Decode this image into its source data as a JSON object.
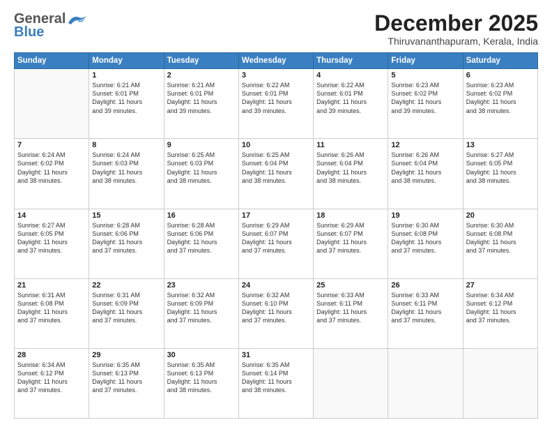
{
  "header": {
    "logo_general": "General",
    "logo_blue": "Blue",
    "month_title": "December 2025",
    "location": "Thiruvananthapuram, Kerala, India"
  },
  "weekdays": [
    "Sunday",
    "Monday",
    "Tuesday",
    "Wednesday",
    "Thursday",
    "Friday",
    "Saturday"
  ],
  "weeks": [
    [
      {
        "day": "",
        "info": ""
      },
      {
        "day": "1",
        "info": "Sunrise: 6:21 AM\nSunset: 6:01 PM\nDaylight: 11 hours\nand 39 minutes."
      },
      {
        "day": "2",
        "info": "Sunrise: 6:21 AM\nSunset: 6:01 PM\nDaylight: 11 hours\nand 39 minutes."
      },
      {
        "day": "3",
        "info": "Sunrise: 6:22 AM\nSunset: 6:01 PM\nDaylight: 11 hours\nand 39 minutes."
      },
      {
        "day": "4",
        "info": "Sunrise: 6:22 AM\nSunset: 6:01 PM\nDaylight: 11 hours\nand 39 minutes."
      },
      {
        "day": "5",
        "info": "Sunrise: 6:23 AM\nSunset: 6:02 PM\nDaylight: 11 hours\nand 39 minutes."
      },
      {
        "day": "6",
        "info": "Sunrise: 6:23 AM\nSunset: 6:02 PM\nDaylight: 11 hours\nand 38 minutes."
      }
    ],
    [
      {
        "day": "7",
        "info": "Sunrise: 6:24 AM\nSunset: 6:02 PM\nDaylight: 11 hours\nand 38 minutes."
      },
      {
        "day": "8",
        "info": "Sunrise: 6:24 AM\nSunset: 6:03 PM\nDaylight: 11 hours\nand 38 minutes."
      },
      {
        "day": "9",
        "info": "Sunrise: 6:25 AM\nSunset: 6:03 PM\nDaylight: 11 hours\nand 38 minutes."
      },
      {
        "day": "10",
        "info": "Sunrise: 6:25 AM\nSunset: 6:04 PM\nDaylight: 11 hours\nand 38 minutes."
      },
      {
        "day": "11",
        "info": "Sunrise: 6:26 AM\nSunset: 6:04 PM\nDaylight: 11 hours\nand 38 minutes."
      },
      {
        "day": "12",
        "info": "Sunrise: 6:26 AM\nSunset: 6:04 PM\nDaylight: 11 hours\nand 38 minutes."
      },
      {
        "day": "13",
        "info": "Sunrise: 6:27 AM\nSunset: 6:05 PM\nDaylight: 11 hours\nand 38 minutes."
      }
    ],
    [
      {
        "day": "14",
        "info": "Sunrise: 6:27 AM\nSunset: 6:05 PM\nDaylight: 11 hours\nand 37 minutes."
      },
      {
        "day": "15",
        "info": "Sunrise: 6:28 AM\nSunset: 6:06 PM\nDaylight: 11 hours\nand 37 minutes."
      },
      {
        "day": "16",
        "info": "Sunrise: 6:28 AM\nSunset: 6:06 PM\nDaylight: 11 hours\nand 37 minutes."
      },
      {
        "day": "17",
        "info": "Sunrise: 6:29 AM\nSunset: 6:07 PM\nDaylight: 11 hours\nand 37 minutes."
      },
      {
        "day": "18",
        "info": "Sunrise: 6:29 AM\nSunset: 6:07 PM\nDaylight: 11 hours\nand 37 minutes."
      },
      {
        "day": "19",
        "info": "Sunrise: 6:30 AM\nSunset: 6:08 PM\nDaylight: 11 hours\nand 37 minutes."
      },
      {
        "day": "20",
        "info": "Sunrise: 6:30 AM\nSunset: 6:08 PM\nDaylight: 11 hours\nand 37 minutes."
      }
    ],
    [
      {
        "day": "21",
        "info": "Sunrise: 6:31 AM\nSunset: 6:08 PM\nDaylight: 11 hours\nand 37 minutes."
      },
      {
        "day": "22",
        "info": "Sunrise: 6:31 AM\nSunset: 6:09 PM\nDaylight: 11 hours\nand 37 minutes."
      },
      {
        "day": "23",
        "info": "Sunrise: 6:32 AM\nSunset: 6:09 PM\nDaylight: 11 hours\nand 37 minutes."
      },
      {
        "day": "24",
        "info": "Sunrise: 6:32 AM\nSunset: 6:10 PM\nDaylight: 11 hours\nand 37 minutes."
      },
      {
        "day": "25",
        "info": "Sunrise: 6:33 AM\nSunset: 6:11 PM\nDaylight: 11 hours\nand 37 minutes."
      },
      {
        "day": "26",
        "info": "Sunrise: 6:33 AM\nSunset: 6:11 PM\nDaylight: 11 hours\nand 37 minutes."
      },
      {
        "day": "27",
        "info": "Sunrise: 6:34 AM\nSunset: 6:12 PM\nDaylight: 11 hours\nand 37 minutes."
      }
    ],
    [
      {
        "day": "28",
        "info": "Sunrise: 6:34 AM\nSunset: 6:12 PM\nDaylight: 11 hours\nand 37 minutes."
      },
      {
        "day": "29",
        "info": "Sunrise: 6:35 AM\nSunset: 6:13 PM\nDaylight: 11 hours\nand 37 minutes."
      },
      {
        "day": "30",
        "info": "Sunrise: 6:35 AM\nSunset: 6:13 PM\nDaylight: 11 hours\nand 38 minutes."
      },
      {
        "day": "31",
        "info": "Sunrise: 6:35 AM\nSunset: 6:14 PM\nDaylight: 11 hours\nand 38 minutes."
      },
      {
        "day": "",
        "info": ""
      },
      {
        "day": "",
        "info": ""
      },
      {
        "day": "",
        "info": ""
      }
    ]
  ]
}
